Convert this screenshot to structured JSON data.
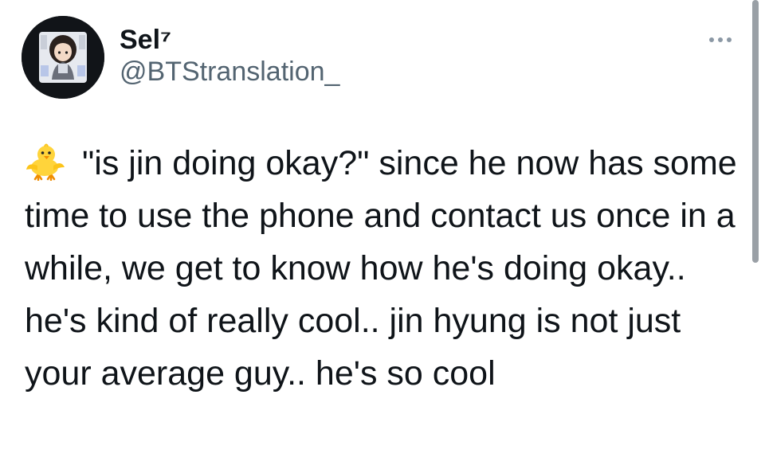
{
  "tweet": {
    "author": {
      "display_name": "Sel⁷",
      "handle": "@BTStranslation_",
      "avatar_icon": "profile-avatar"
    },
    "more_icon": "more-horizontal-icon",
    "emoji_icon": "baby-chick-icon",
    "text": "\"is jin doing okay?\" since he now has some time to use the phone and contact us once in a while, we get to know how he's doing okay.. he's kind of really cool.. jin hyung is not just your average guy.. he's so cool"
  },
  "colors": {
    "text": "#0f1419",
    "secondary": "#536471",
    "avatar_bg": "#111418",
    "chick": "#ffd43b"
  }
}
